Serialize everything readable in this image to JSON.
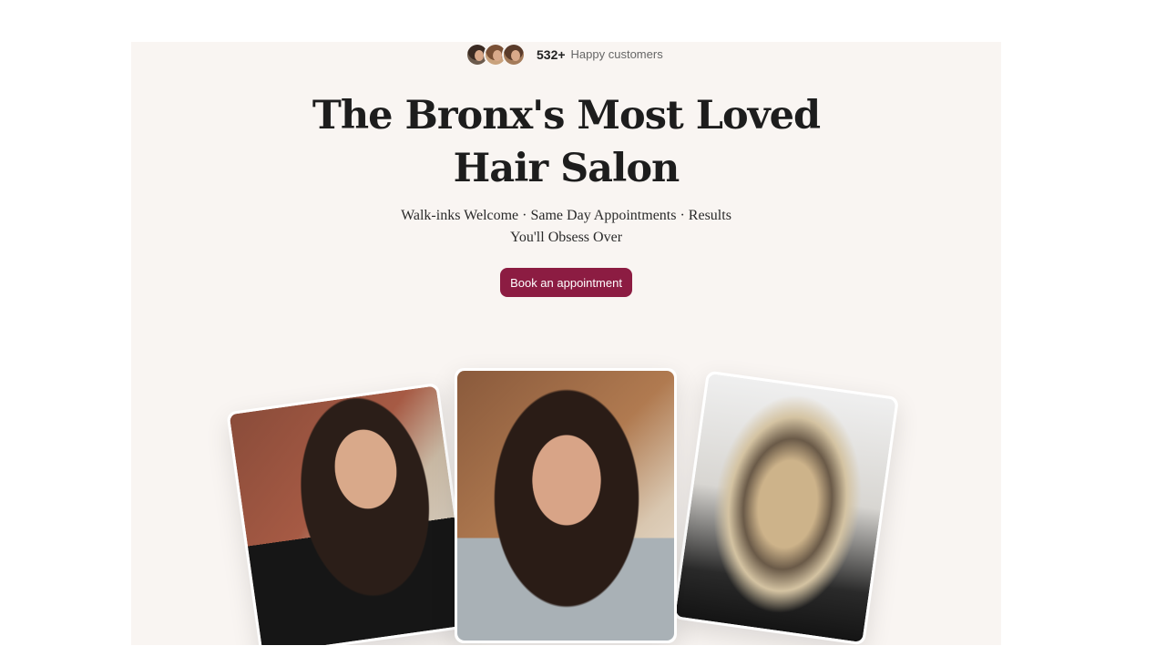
{
  "social_proof": {
    "count": "532+",
    "label": "Happy customers",
    "avatars": [
      "customer-avatar-1",
      "customer-avatar-2",
      "customer-avatar-3"
    ]
  },
  "hero": {
    "headline_line1": "The Bronx's Most Loved",
    "headline_line2": "Hair Salon",
    "subhead_line1": "Walk-inks Welcome · Same Day Appointments  ·  Results",
    "subhead_line2": "You'll Obsess Over",
    "cta_label": "Book an appointment"
  },
  "colors": {
    "hero_background": "#f9f5f2",
    "cta_background": "#8c1c42",
    "headline_text": "#1d1d1d"
  },
  "gallery": {
    "photos": [
      "bridal-waves-photo",
      "bridal-glam-photo",
      "balayage-waves-photo"
    ]
  }
}
